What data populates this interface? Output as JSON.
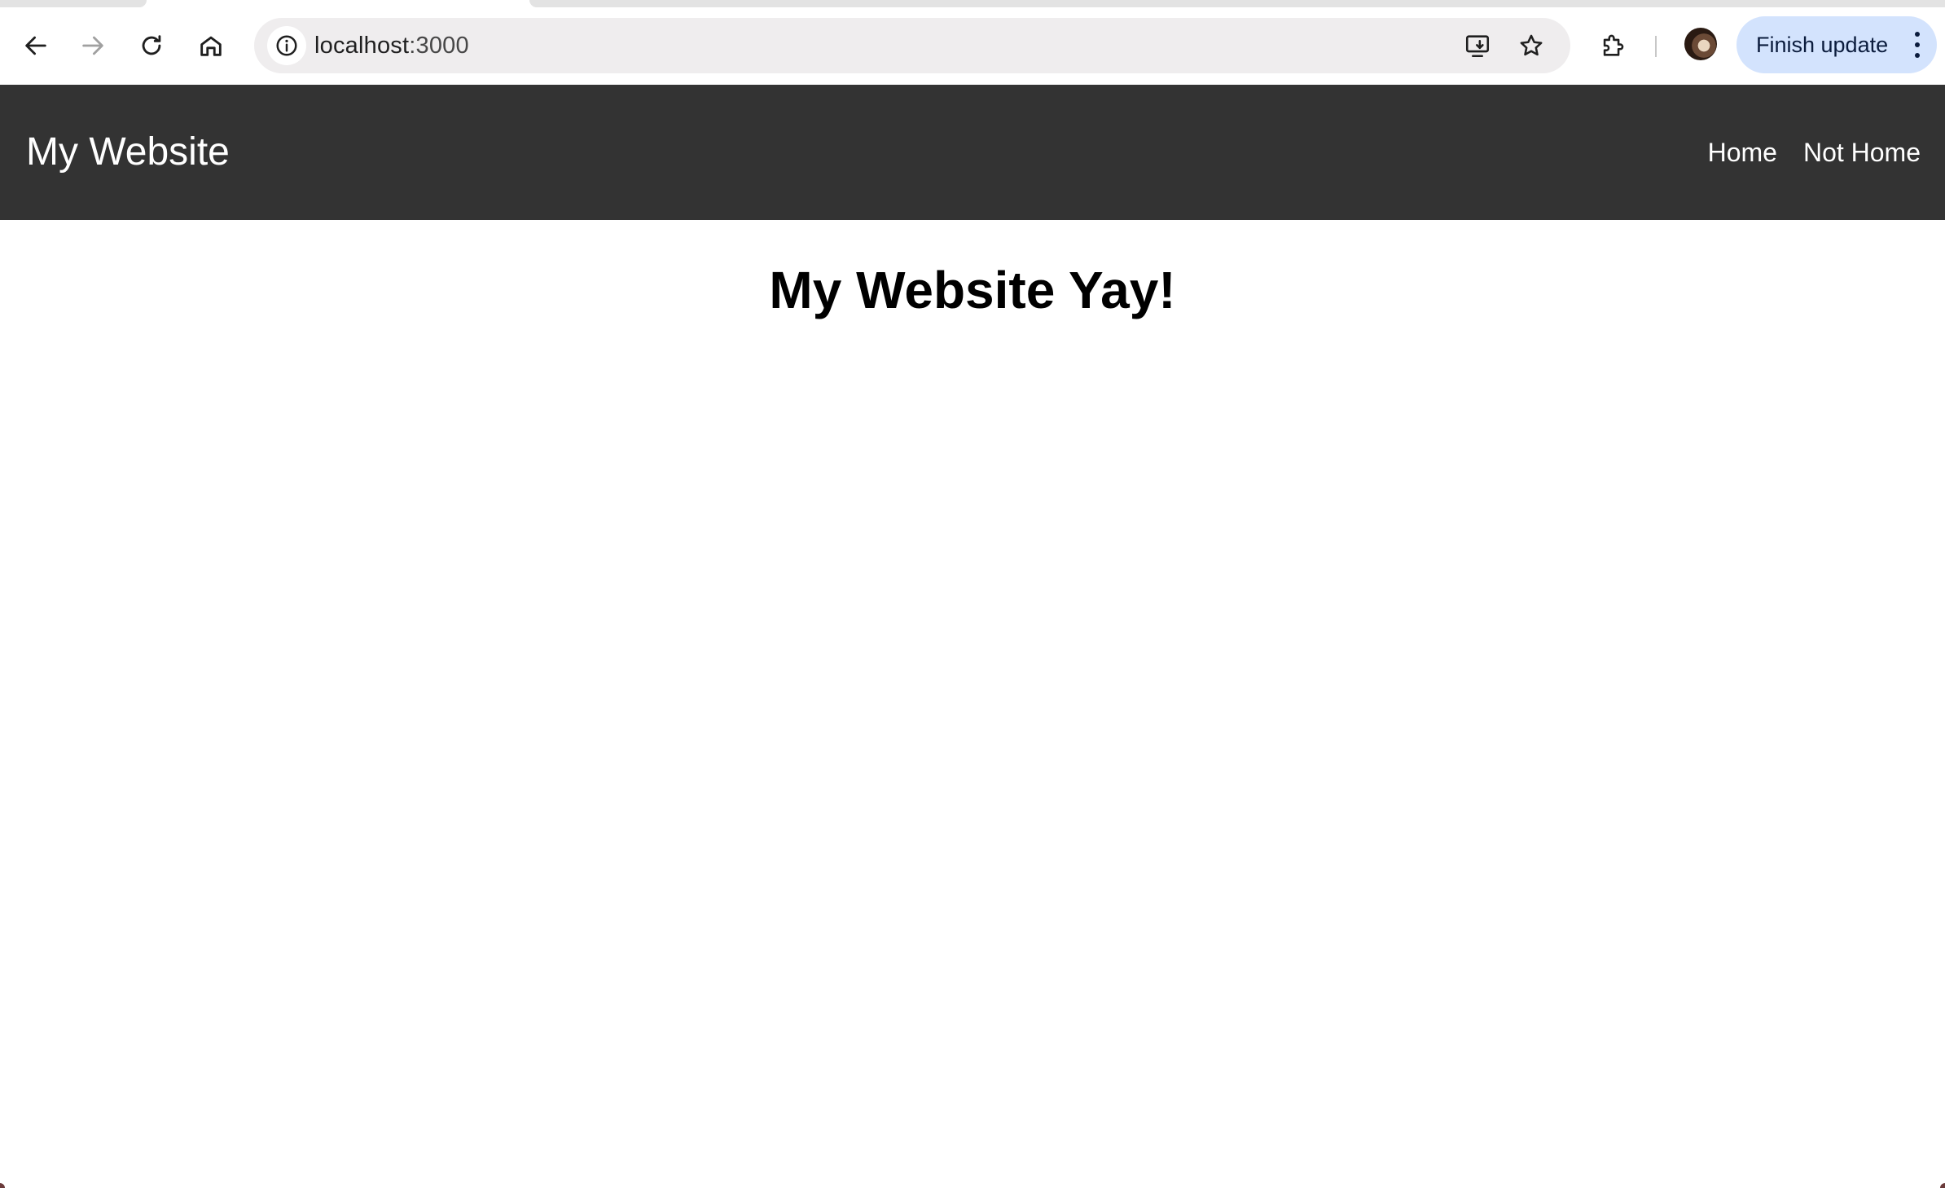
{
  "browser": {
    "url_host": "localhost",
    "url_port": ":3000",
    "finish_update_label": "Finish update"
  },
  "icons": {
    "back": "back-arrow-icon",
    "forward": "forward-arrow-icon",
    "reload": "reload-icon",
    "home": "home-icon",
    "site_info": "info-icon",
    "install_app": "install-app-icon",
    "bookmark": "star-icon",
    "extensions": "puzzle-icon",
    "menu": "kebab-menu-icon"
  },
  "colors": {
    "navbar_bg": "#333333",
    "finish_update_bg": "#d3e3fd",
    "omnibox_bg": "#efedee"
  },
  "site": {
    "brand": "My Website",
    "nav": [
      {
        "label": "Home"
      },
      {
        "label": "Not Home"
      }
    ],
    "heading": "My Website Yay!"
  }
}
